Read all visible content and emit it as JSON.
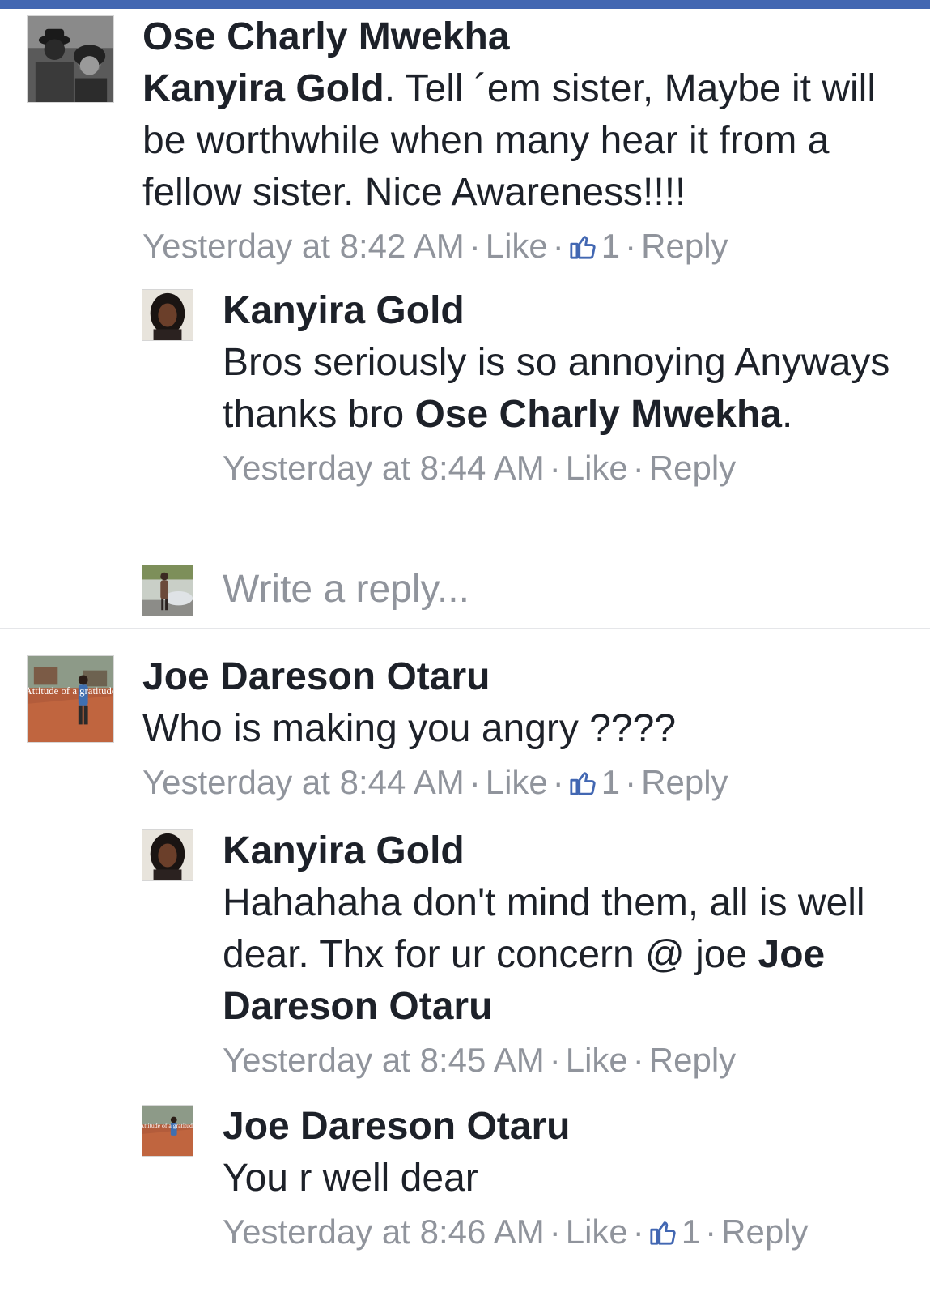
{
  "colors": {
    "brand_bar": "#4267b2",
    "meta_gray": "#90949c",
    "text": "#1d2129"
  },
  "comments": [
    {
      "author": "Ose Charly Mwekha",
      "mention": "Kanyira Gold",
      "text": ". Tell ´em sister,  Maybe it will be worthwhile when many hear it from a fellow sister. Nice Awareness!!!!",
      "time": "Yesterday at 8:42 AM",
      "like": "Like",
      "likes": "1",
      "reply": "Reply"
    },
    {
      "author": "Kanyira Gold",
      "text": "Bros seriously is so annoying Anyways thanks bro ",
      "mention": "Ose Charly Mwekha",
      "text_after": ".",
      "time": "Yesterday at 8:44 AM",
      "like": "Like",
      "reply": "Reply"
    },
    {
      "author": "Joe Dareson Otaru",
      "avatar_caption": "Attitude of a gratitude",
      "text": "Who is making you angry ????",
      "time": "Yesterday at 8:44 AM",
      "like": "Like",
      "likes": "1",
      "reply": "Reply"
    },
    {
      "author": "Kanyira Gold",
      "text": "Hahahaha don't mind them, all is well dear. Thx for ur concern @ joe ",
      "mention": "Joe Dareson Otaru",
      "time": "Yesterday at 8:45 AM",
      "like": "Like",
      "reply": "Reply"
    },
    {
      "author": "Joe Dareson Otaru",
      "avatar_caption": "Attitude of a gratitude",
      "text": "You r well dear",
      "time": "Yesterday at 8:46 AM",
      "like": "Like",
      "likes": "1",
      "reply": "Reply"
    }
  ],
  "reply_box": {
    "placeholder": "Write a reply..."
  },
  "separator": "·"
}
